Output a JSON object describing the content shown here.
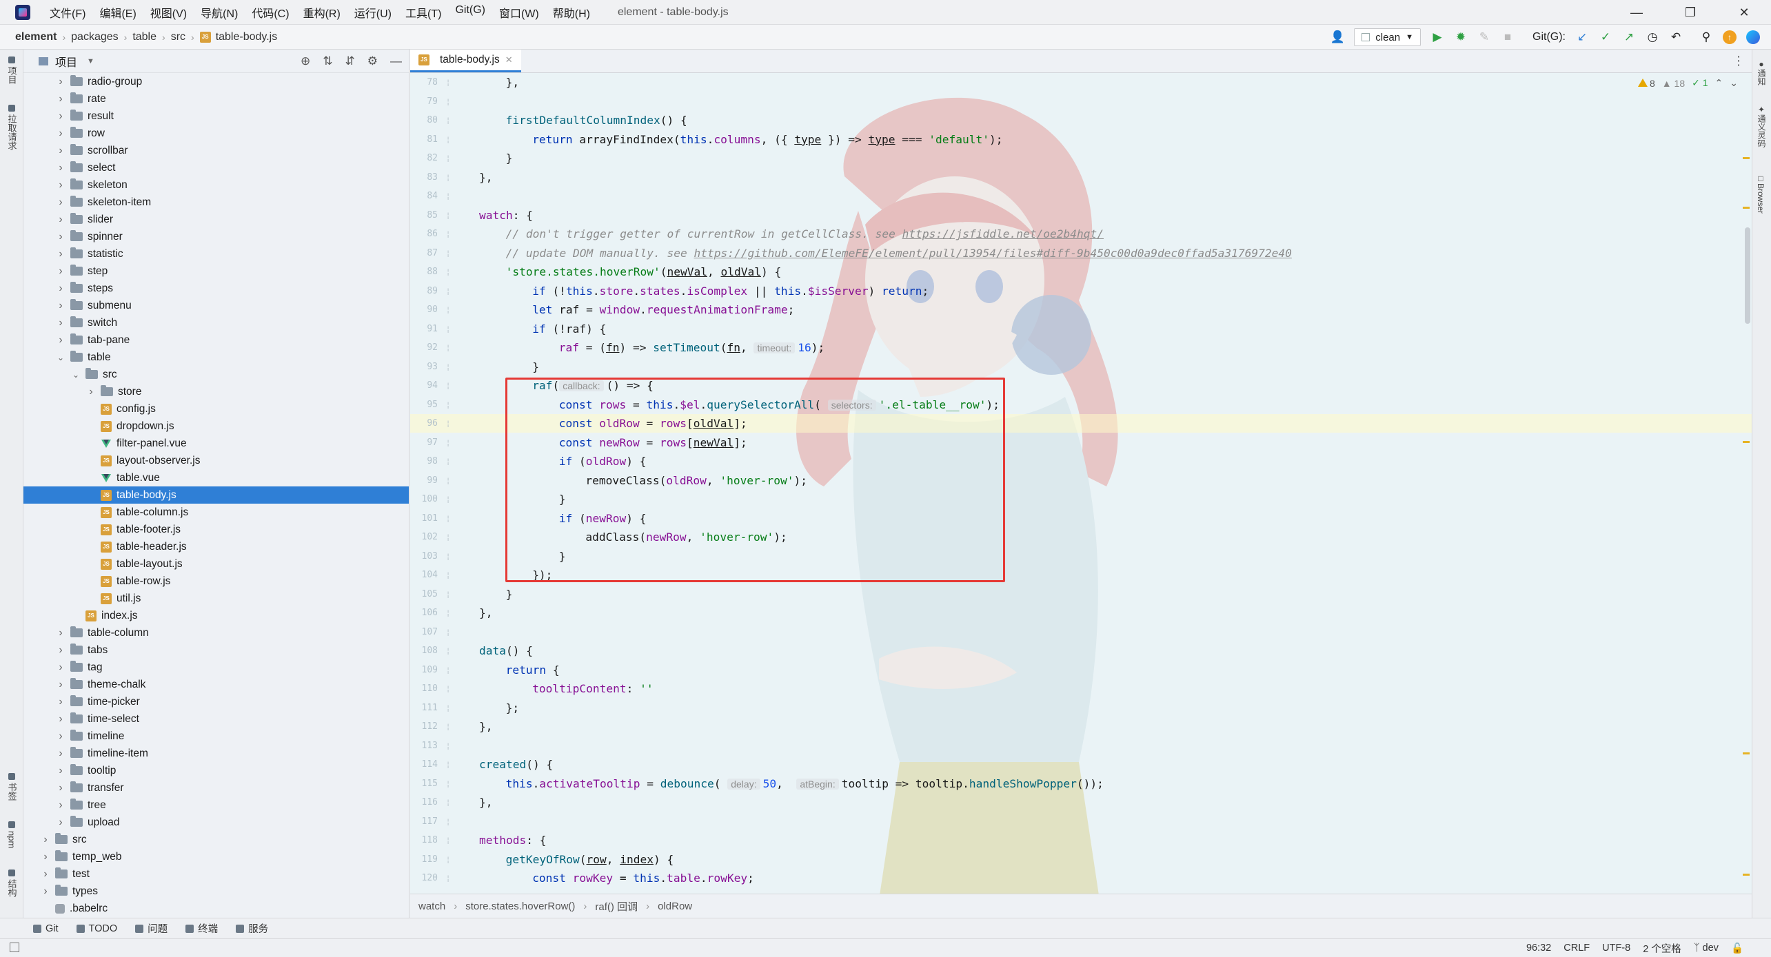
{
  "titlebar": {
    "menus": [
      "文件(F)",
      "编辑(E)",
      "视图(V)",
      "导航(N)",
      "代码(C)",
      "重构(R)",
      "运行(U)",
      "工具(T)",
      "Git(G)",
      "窗口(W)",
      "帮助(H)"
    ],
    "window_title": "element - table-body.js"
  },
  "navbar": {
    "breadcrumbs": [
      "element",
      "packages",
      "table",
      "src",
      "table-body.js"
    ],
    "run_config": "clean",
    "git_label": "Git(G):"
  },
  "left_strip": {
    "project": "项目",
    "pull_requests": "拉取请求",
    "bookmarks": "书签",
    "npm": "npm",
    "structure": "结构"
  },
  "right_strip": {
    "notifications": "通知",
    "ai": "通义灵码",
    "browser": "Browser"
  },
  "project_panel": {
    "title": "项目",
    "tree": [
      {
        "label": "radio-group",
        "type": "folder",
        "depth": 2
      },
      {
        "label": "rate",
        "type": "folder",
        "depth": 2
      },
      {
        "label": "result",
        "type": "folder",
        "depth": 2
      },
      {
        "label": "row",
        "type": "folder",
        "depth": 2
      },
      {
        "label": "scrollbar",
        "type": "folder",
        "depth": 2
      },
      {
        "label": "select",
        "type": "folder",
        "depth": 2
      },
      {
        "label": "skeleton",
        "type": "folder",
        "depth": 2
      },
      {
        "label": "skeleton-item",
        "type": "folder",
        "depth": 2
      },
      {
        "label": "slider",
        "type": "folder",
        "depth": 2
      },
      {
        "label": "spinner",
        "type": "folder",
        "depth": 2
      },
      {
        "label": "statistic",
        "type": "folder",
        "depth": 2
      },
      {
        "label": "step",
        "type": "folder",
        "depth": 2
      },
      {
        "label": "steps",
        "type": "folder",
        "depth": 2
      },
      {
        "label": "submenu",
        "type": "folder",
        "depth": 2
      },
      {
        "label": "switch",
        "type": "folder",
        "depth": 2
      },
      {
        "label": "tab-pane",
        "type": "folder",
        "depth": 2
      },
      {
        "label": "table",
        "type": "folder",
        "depth": 2,
        "open": true
      },
      {
        "label": "src",
        "type": "folder",
        "depth": 3,
        "open": true
      },
      {
        "label": "store",
        "type": "folder",
        "depth": 4
      },
      {
        "label": "config.js",
        "type": "js",
        "depth": 4
      },
      {
        "label": "dropdown.js",
        "type": "js",
        "depth": 4
      },
      {
        "label": "filter-panel.vue",
        "type": "vue",
        "depth": 4
      },
      {
        "label": "layout-observer.js",
        "type": "js",
        "depth": 4
      },
      {
        "label": "table.vue",
        "type": "vue",
        "depth": 4
      },
      {
        "label": "table-body.js",
        "type": "js",
        "depth": 4,
        "selected": true
      },
      {
        "label": "table-column.js",
        "type": "js",
        "depth": 4
      },
      {
        "label": "table-footer.js",
        "type": "js",
        "depth": 4
      },
      {
        "label": "table-header.js",
        "type": "js",
        "depth": 4
      },
      {
        "label": "table-layout.js",
        "type": "js",
        "depth": 4
      },
      {
        "label": "table-row.js",
        "type": "js",
        "depth": 4
      },
      {
        "label": "util.js",
        "type": "js",
        "depth": 4
      },
      {
        "label": "index.js",
        "type": "js",
        "depth": 3
      },
      {
        "label": "table-column",
        "type": "folder",
        "depth": 2
      },
      {
        "label": "tabs",
        "type": "folder",
        "depth": 2
      },
      {
        "label": "tag",
        "type": "folder",
        "depth": 2
      },
      {
        "label": "theme-chalk",
        "type": "folder",
        "depth": 2
      },
      {
        "label": "time-picker",
        "type": "folder",
        "depth": 2
      },
      {
        "label": "time-select",
        "type": "folder",
        "depth": 2
      },
      {
        "label": "timeline",
        "type": "folder",
        "depth": 2
      },
      {
        "label": "timeline-item",
        "type": "folder",
        "depth": 2
      },
      {
        "label": "tooltip",
        "type": "folder",
        "depth": 2
      },
      {
        "label": "transfer",
        "type": "folder",
        "depth": 2
      },
      {
        "label": "tree",
        "type": "folder",
        "depth": 2
      },
      {
        "label": "upload",
        "type": "folder",
        "depth": 2
      },
      {
        "label": "src",
        "type": "folder",
        "depth": 1
      },
      {
        "label": "temp_web",
        "type": "folder",
        "depth": 1
      },
      {
        "label": "test",
        "type": "folder",
        "depth": 1
      },
      {
        "label": "types",
        "type": "folder",
        "depth": 1
      },
      {
        "label": ".babelrc",
        "type": "file",
        "depth": 1
      }
    ]
  },
  "editor": {
    "tab": "table-body.js",
    "inspections": {
      "warnings": "8",
      "weak": "18",
      "ok": "1"
    },
    "current_line": 96,
    "lines": [
      {
        "n": "78",
        "i": 1,
        "code": [
          [
            "},",
            ""
          ]
        ]
      },
      {
        "n": "79",
        "i": 0,
        "code": []
      },
      {
        "n": "80",
        "i": 1,
        "code": [
          [
            "firstDefaultColumnIndex",
            "f"
          ],
          [
            "() {",
            ""
          ]
        ]
      },
      {
        "n": "81",
        "i": 2,
        "code": [
          [
            "return ",
            "k"
          ],
          [
            "arrayFindIndex(",
            ""
          ],
          [
            "this",
            "k"
          ],
          [
            ".",
            ""
          ],
          [
            "columns",
            "p"
          ],
          [
            ", ({ ",
            ""
          ],
          [
            "type",
            "u"
          ],
          [
            " }) => ",
            ""
          ],
          [
            "type",
            "u"
          ],
          [
            " === ",
            ""
          ],
          [
            "'default'",
            "s"
          ],
          [
            ");",
            ""
          ]
        ]
      },
      {
        "n": "82",
        "i": 1,
        "code": [
          [
            "}",
            ""
          ]
        ]
      },
      {
        "n": "83",
        "i": 0,
        "code": [
          [
            "},",
            ""
          ]
        ]
      },
      {
        "n": "84",
        "i": 0,
        "code": []
      },
      {
        "n": "85",
        "i": 0,
        "code": [
          [
            "watch",
            "p"
          ],
          [
            ": {",
            ""
          ]
        ]
      },
      {
        "n": "86",
        "i": 1,
        "code": [
          [
            "// don't trigger getter of currentRow in getCellClass. see ",
            "c"
          ],
          [
            "https://jsfiddle.net/oe2b4hqt/",
            "c u"
          ]
        ]
      },
      {
        "n": "87",
        "i": 1,
        "code": [
          [
            "// update DOM manually. see ",
            "c"
          ],
          [
            "https://github.com/ElemeFE/element/pull/13954/files#diff-9b450c00d0a9dec0ffad5a3176972e40",
            "c u"
          ]
        ]
      },
      {
        "n": "88",
        "i": 1,
        "code": [
          [
            "'store.states.hoverRow'",
            "s"
          ],
          [
            "(",
            ""
          ],
          [
            "newVal",
            "u"
          ],
          [
            ", ",
            ""
          ],
          [
            "oldVal",
            "u"
          ],
          [
            ") {",
            ""
          ]
        ]
      },
      {
        "n": "89",
        "i": 2,
        "code": [
          [
            "if ",
            "k"
          ],
          [
            "(!",
            ""
          ],
          [
            "this",
            "k"
          ],
          [
            ".",
            ""
          ],
          [
            "store",
            "p"
          ],
          [
            ".",
            ""
          ],
          [
            "states",
            "p"
          ],
          [
            ".",
            ""
          ],
          [
            "isComplex",
            "p"
          ],
          [
            " || ",
            ""
          ],
          [
            "this",
            "k"
          ],
          [
            ".",
            ""
          ],
          [
            "$isServer",
            "p"
          ],
          [
            ") ",
            ""
          ],
          [
            "return",
            "k"
          ],
          [
            ";",
            ""
          ]
        ]
      },
      {
        "n": "90",
        "i": 2,
        "code": [
          [
            "let ",
            "k"
          ],
          [
            "raf",
            ""
          ],
          [
            " = ",
            ""
          ],
          [
            "window",
            "p"
          ],
          [
            ".",
            ""
          ],
          [
            "requestAnimationFrame",
            "p"
          ],
          [
            ";",
            ""
          ]
        ]
      },
      {
        "n": "91",
        "i": 2,
        "code": [
          [
            "if ",
            "k"
          ],
          [
            "(!raf) {",
            ""
          ]
        ]
      },
      {
        "n": "92",
        "i": 3,
        "code": [
          [
            "raf",
            "p"
          ],
          [
            " = (",
            ""
          ],
          [
            "fn",
            "u"
          ],
          [
            ") => ",
            ""
          ],
          [
            "setTimeout",
            "f"
          ],
          [
            "(",
            ""
          ],
          [
            "fn",
            "u"
          ],
          [
            ", ",
            ""
          ],
          [
            "timeout:",
            "h"
          ],
          [
            "16",
            "n"
          ],
          [
            ");",
            ""
          ]
        ]
      },
      {
        "n": "93",
        "i": 2,
        "code": [
          [
            "}",
            ""
          ]
        ]
      },
      {
        "n": "94",
        "i": 2,
        "code": [
          [
            "raf",
            "f"
          ],
          [
            "(",
            ""
          ],
          [
            "callback:",
            "h"
          ],
          [
            "() => {",
            ""
          ]
        ]
      },
      {
        "n": "95",
        "i": 3,
        "code": [
          [
            "const ",
            "k"
          ],
          [
            "rows",
            "p"
          ],
          [
            " = ",
            ""
          ],
          [
            "this",
            "k"
          ],
          [
            ".",
            ""
          ],
          [
            "$el",
            "p"
          ],
          [
            ".",
            ""
          ],
          [
            "querySelectorAll",
            "f"
          ],
          [
            "( ",
            ""
          ],
          [
            "selectors:",
            "h"
          ],
          [
            "'.el-table__row'",
            "s"
          ],
          [
            ");",
            ""
          ]
        ]
      },
      {
        "n": "96",
        "i": 3,
        "code": [
          [
            "const ",
            "k"
          ],
          [
            "oldRow",
            "p"
          ],
          [
            " = ",
            ""
          ],
          [
            "rows",
            "p"
          ],
          [
            "[",
            ""
          ],
          [
            "oldVal",
            "u"
          ],
          [
            "];",
            ""
          ]
        ]
      },
      {
        "n": "97",
        "i": 3,
        "code": [
          [
            "const ",
            "k"
          ],
          [
            "newRow",
            "p"
          ],
          [
            " = ",
            ""
          ],
          [
            "rows",
            "p"
          ],
          [
            "[",
            ""
          ],
          [
            "newVal",
            "u"
          ],
          [
            "];",
            ""
          ]
        ]
      },
      {
        "n": "98",
        "i": 3,
        "code": [
          [
            "if ",
            "k"
          ],
          [
            "(",
            ""
          ],
          [
            "oldRow",
            "p"
          ],
          [
            ") {",
            ""
          ]
        ]
      },
      {
        "n": "99",
        "i": 4,
        "code": [
          [
            "removeClass(",
            ""
          ],
          [
            "oldRow",
            "p"
          ],
          [
            ", ",
            ""
          ],
          [
            "'hover-row'",
            "s"
          ],
          [
            ");",
            ""
          ]
        ]
      },
      {
        "n": "100",
        "i": 3,
        "code": [
          [
            "}",
            ""
          ]
        ]
      },
      {
        "n": "101",
        "i": 3,
        "code": [
          [
            "if ",
            "k"
          ],
          [
            "(",
            ""
          ],
          [
            "newRow",
            "p"
          ],
          [
            ") {",
            ""
          ]
        ]
      },
      {
        "n": "102",
        "i": 4,
        "code": [
          [
            "addClass(",
            ""
          ],
          [
            "newRow",
            "p"
          ],
          [
            ", ",
            ""
          ],
          [
            "'hover-row'",
            "s"
          ],
          [
            ");",
            ""
          ]
        ]
      },
      {
        "n": "103",
        "i": 3,
        "code": [
          [
            "}",
            ""
          ]
        ]
      },
      {
        "n": "104",
        "i": 2,
        "code": [
          [
            "});",
            ""
          ]
        ]
      },
      {
        "n": "105",
        "i": 1,
        "code": [
          [
            "}",
            ""
          ]
        ]
      },
      {
        "n": "106",
        "i": 0,
        "code": [
          [
            "},",
            ""
          ]
        ]
      },
      {
        "n": "107",
        "i": 0,
        "code": []
      },
      {
        "n": "108",
        "i": 0,
        "code": [
          [
            "data",
            "f"
          ],
          [
            "() {",
            ""
          ]
        ]
      },
      {
        "n": "109",
        "i": 1,
        "code": [
          [
            "return ",
            "k"
          ],
          [
            "{",
            ""
          ]
        ]
      },
      {
        "n": "110",
        "i": 2,
        "code": [
          [
            "tooltipContent",
            "p"
          ],
          [
            ": ",
            ""
          ],
          [
            "''",
            "s"
          ]
        ]
      },
      {
        "n": "111",
        "i": 1,
        "code": [
          [
            "};",
            ""
          ]
        ]
      },
      {
        "n": "112",
        "i": 0,
        "code": [
          [
            "},",
            ""
          ]
        ]
      },
      {
        "n": "113",
        "i": 0,
        "code": []
      },
      {
        "n": "114",
        "i": 0,
        "code": [
          [
            "created",
            "f"
          ],
          [
            "() {",
            ""
          ]
        ]
      },
      {
        "n": "115",
        "i": 1,
        "code": [
          [
            "this",
            "k"
          ],
          [
            ".",
            ""
          ],
          [
            "activateTooltip",
            "p"
          ],
          [
            " = ",
            ""
          ],
          [
            "debounce",
            "f"
          ],
          [
            "( ",
            ""
          ],
          [
            "delay:",
            "h"
          ],
          [
            "50",
            "n"
          ],
          [
            ",  ",
            ""
          ],
          [
            "atBegin:",
            "h"
          ],
          [
            "tooltip => tooltip.",
            ""
          ],
          [
            "handleShowPopper",
            "f"
          ],
          [
            "());",
            ""
          ]
        ]
      },
      {
        "n": "116",
        "i": 0,
        "code": [
          [
            "},",
            ""
          ]
        ]
      },
      {
        "n": "117",
        "i": 0,
        "code": []
      },
      {
        "n": "118",
        "i": 0,
        "code": [
          [
            "methods",
            "p"
          ],
          [
            ": {",
            ""
          ]
        ]
      },
      {
        "n": "119",
        "i": 1,
        "code": [
          [
            "getKeyOfRow",
            "f"
          ],
          [
            "(",
            ""
          ],
          [
            "row",
            "u"
          ],
          [
            ", ",
            ""
          ],
          [
            "index",
            "u"
          ],
          [
            ") {",
            ""
          ]
        ]
      },
      {
        "n": "120",
        "i": 2,
        "code": [
          [
            "const ",
            "k"
          ],
          [
            "rowKey",
            "p"
          ],
          [
            " = ",
            ""
          ],
          [
            "this",
            "k"
          ],
          [
            ".",
            ""
          ],
          [
            "table",
            "p"
          ],
          [
            ".",
            ""
          ],
          [
            "rowKey",
            "p"
          ],
          [
            ";",
            ""
          ]
        ]
      }
    ],
    "breadcrumbs": [
      "watch",
      "store.states.hoverRow()",
      "raf() 回调",
      "oldRow"
    ]
  },
  "bottom_tools": [
    "Git",
    "TODO",
    "问题",
    "终端",
    "服务"
  ],
  "statusbar": {
    "position": "96:32",
    "line_sep": "CRLF",
    "encoding": "UTF-8",
    "indent": "2 个空格",
    "branch": "dev"
  }
}
